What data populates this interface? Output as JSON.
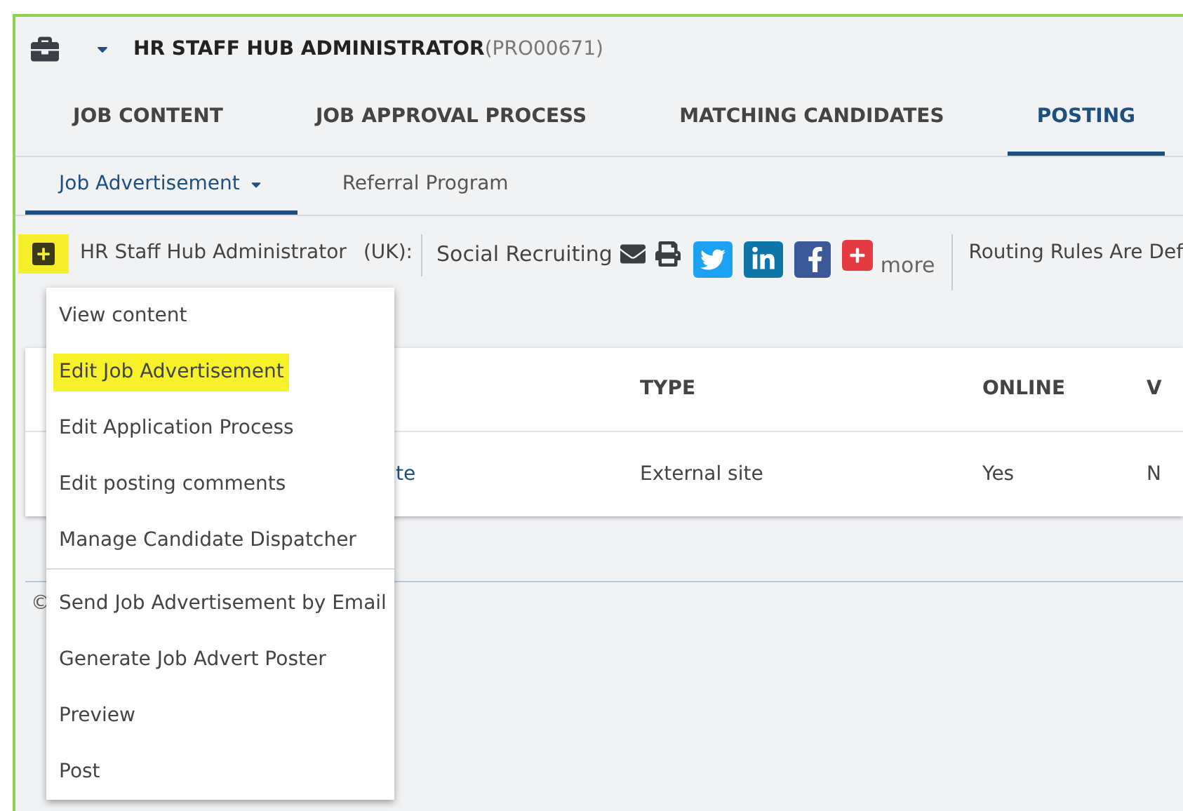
{
  "header": {
    "title": "HR STAFF HUB ADMINISTRATOR",
    "code": "(PRO00671)"
  },
  "tabs": [
    {
      "label": "JOB CONTENT",
      "selected": false
    },
    {
      "label": "JOB APPROVAL PROCESS",
      "selected": false
    },
    {
      "label": "MATCHING CANDIDATES",
      "selected": false
    },
    {
      "label": "POSTING",
      "selected": true
    }
  ],
  "subtabs": [
    {
      "label": "Job Advertisement",
      "selected": true,
      "dropdown": true
    },
    {
      "label": "Referral Program",
      "selected": false,
      "dropdown": false
    }
  ],
  "toolbar": {
    "site": "HR Staff Hub Administrator",
    "locale": "(UK):",
    "social_label": "Social Recruiting",
    "more": "more",
    "routing": "Routing Rules Are Def"
  },
  "table": {
    "columns": [
      "",
      "TYPE",
      "ONLINE",
      "V"
    ],
    "rows": [
      {
        "cells": [
          "te",
          "External site",
          "Yes",
          "N"
        ]
      }
    ]
  },
  "footer": {
    "text": "©"
  },
  "menu": {
    "groups": [
      [
        {
          "label": "View content",
          "highlighted": false
        },
        {
          "label": "Edit Job Advertisement",
          "highlighted": true
        },
        {
          "label": "Edit Application Process",
          "highlighted": false
        },
        {
          "label": "Edit posting comments",
          "highlighted": false
        },
        {
          "label": "Manage Candidate Dispatcher",
          "highlighted": false
        }
      ],
      [
        {
          "label": "Send Job Advertisement by Email",
          "highlighted": false
        },
        {
          "label": "Generate Job Advert Poster",
          "highlighted": false
        },
        {
          "label": "Preview",
          "highlighted": false
        },
        {
          "label": "Post",
          "highlighted": false
        }
      ]
    ]
  }
}
